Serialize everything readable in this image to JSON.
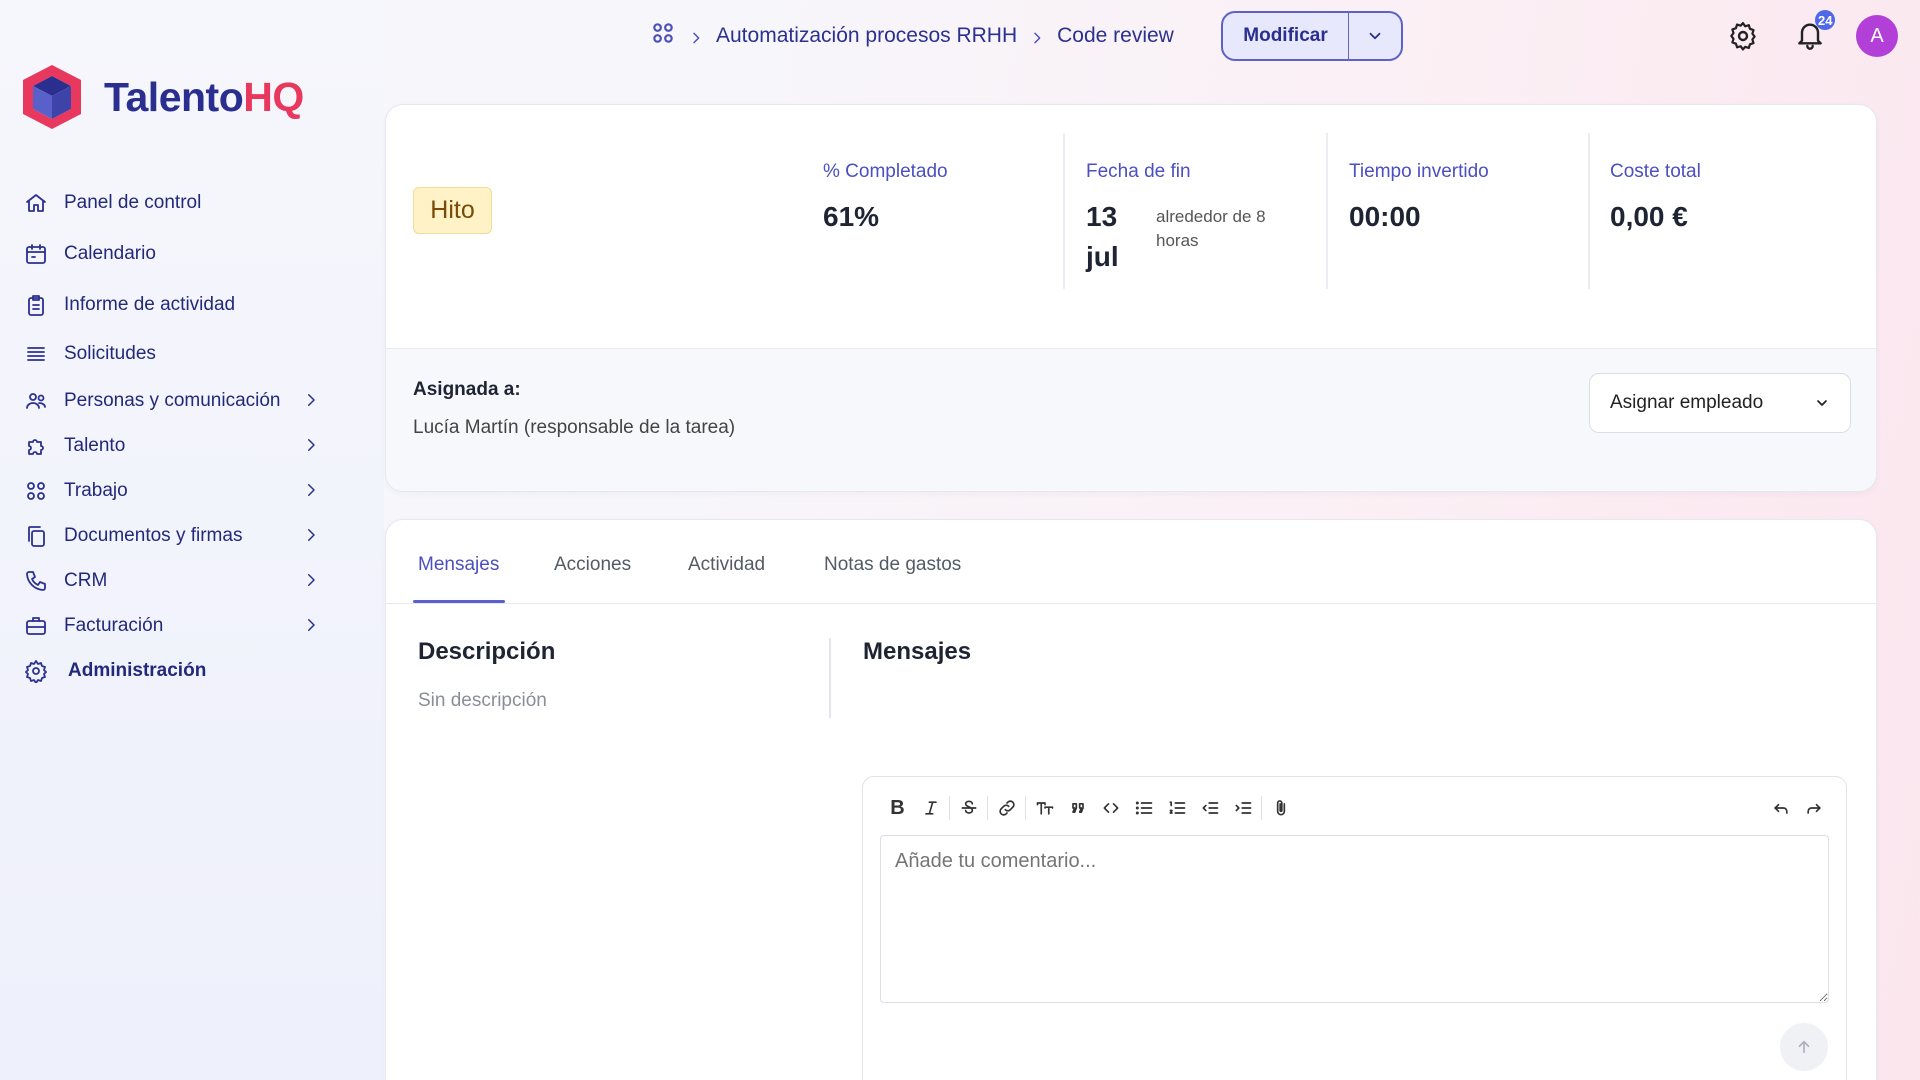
{
  "brand": {
    "name_part1": "Talento",
    "name_part2": "HQ",
    "primary": "#2a2f8f",
    "accent": "#e8385e"
  },
  "sidebar": {
    "items": [
      {
        "label": "Panel de control",
        "icon": "home-icon",
        "expandable": false
      },
      {
        "label": "Calendario",
        "icon": "calendar-icon",
        "expandable": false
      },
      {
        "label": "Informe de actividad",
        "icon": "report-icon",
        "expandable": false
      },
      {
        "label": "Solicitudes",
        "icon": "list-icon",
        "expandable": false
      },
      {
        "label": "Personas y comunicación",
        "icon": "people-icon",
        "expandable": true
      },
      {
        "label": "Talento",
        "icon": "puzzle-icon",
        "expandable": true
      },
      {
        "label": "Trabajo",
        "icon": "grid-icon",
        "expandable": true
      },
      {
        "label": "Documentos y firmas",
        "icon": "documents-icon",
        "expandable": true
      },
      {
        "label": "CRM",
        "icon": "phone-icon",
        "expandable": true
      },
      {
        "label": "Facturación",
        "icon": "briefcase-icon",
        "expandable": true
      },
      {
        "label": "Administración",
        "icon": "gear-icon",
        "expandable": false
      }
    ]
  },
  "header": {
    "breadcrumb": [
      "Automatización procesos RRHH",
      "Code review"
    ],
    "modify_label": "Modificar",
    "notifications_count": "24",
    "avatar_initial": "A"
  },
  "summary": {
    "badge": "Hito",
    "completed": {
      "label": "% Completado",
      "value": "61%"
    },
    "end_date": {
      "label": "Fecha de fin",
      "day": "13",
      "month": "jul",
      "note": "alrededor de 8 horas"
    },
    "time_spent": {
      "label": "Tiempo invertido",
      "value": "00:00"
    },
    "total_cost": {
      "label": "Coste total",
      "value": "0,00 €"
    },
    "assigned": {
      "title": "Asignada a:",
      "name": "Lucía Martín (responsable de la tarea)",
      "select_label": "Asignar empleado"
    }
  },
  "tabs": {
    "items": [
      "Mensajes",
      "Acciones",
      "Actividad",
      "Notas de gastos"
    ],
    "active": "Mensajes"
  },
  "content": {
    "description_title": "Descripción",
    "description_text": "Sin descripción",
    "messages_title": "Mensajes",
    "comment_placeholder": "Añade tu comentario..."
  }
}
